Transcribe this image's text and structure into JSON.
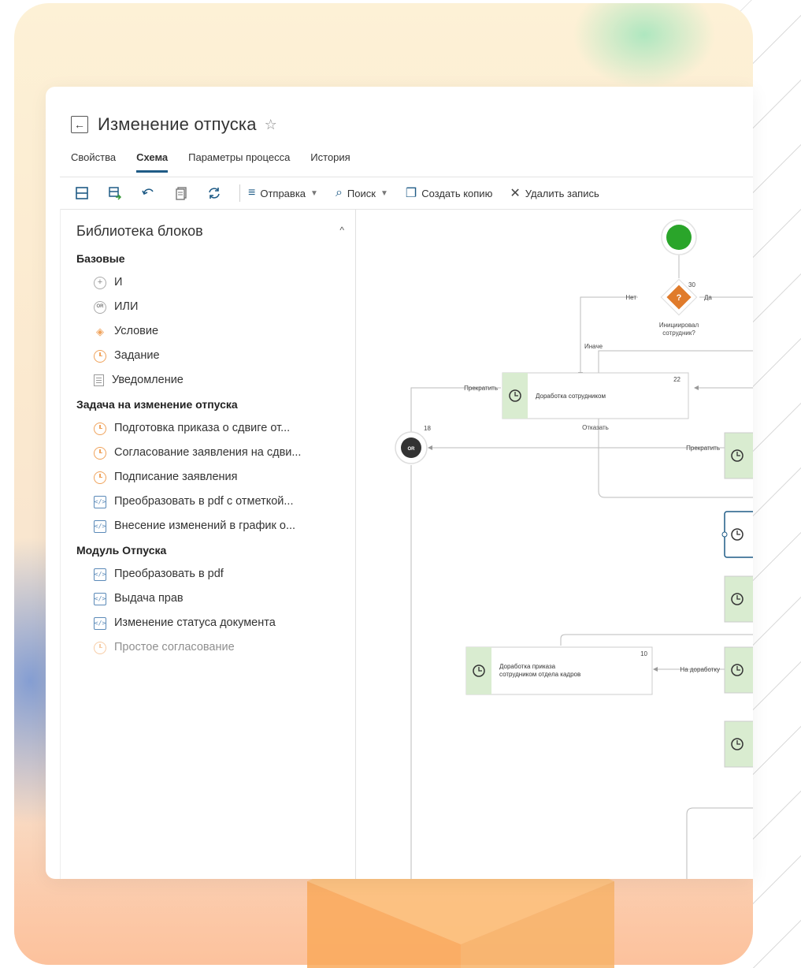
{
  "window": {
    "title": "Изменение отпуска"
  },
  "tabs": [
    {
      "label": "Свойства"
    },
    {
      "label": "Схема"
    },
    {
      "label": "Параметры процесса"
    },
    {
      "label": "История"
    }
  ],
  "toolbar": {
    "send_label": "Отправка",
    "search_label": "Поиск",
    "copy_label": "Создать копию",
    "delete_label": "Удалить запись"
  },
  "sidebar": {
    "title": "Библиотека блоков",
    "groups": [
      {
        "title": "Базовые",
        "items": [
          "И",
          "ИЛИ",
          "Условие",
          "Задание",
          "Уведомление"
        ]
      },
      {
        "title": "Задача на изменение отпуска",
        "items": [
          "Подготовка приказа о сдвиге от...",
          "Согласование заявления на сдви...",
          "Подписание заявления",
          "Преобразовать в pdf с отметкой...",
          "Внесение изменений в график о..."
        ]
      },
      {
        "title": "Модуль Отпуска",
        "items": [
          "Преобразовать в pdf",
          "Выдача прав",
          "Изменение статуса документа",
          "Простое согласование"
        ]
      }
    ]
  },
  "diagram": {
    "condition_number": "30",
    "condition_label_1": "Инициировал",
    "condition_label_2": "сотрудник?",
    "no_label": "Нет",
    "yes_label": "Да",
    "else_label": "Иначе",
    "task1_number": "22",
    "task1_label": "Доработка сотрудником",
    "stop_label_1": "Прекратить",
    "refuse_label": "Отказать",
    "or_number": "18",
    "or_label": "OR",
    "stop_label_2": "Прекратить",
    "task2_number": "10",
    "task2_label_1": "Доработка приказа",
    "task2_label_2": "сотрудником отдела кадров",
    "rework_label": "На доработку"
  },
  "colors": {
    "accent": "#1f5b86",
    "start_node": "#2aa52a",
    "condition": "#e07b2b",
    "task_fill": "#d9ecd0"
  }
}
